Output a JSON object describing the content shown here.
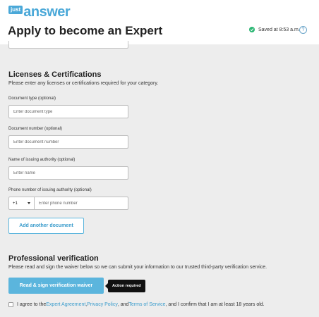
{
  "header": {
    "logo_just": "just",
    "logo_answer": "answer",
    "title": "Apply to become an Expert",
    "saved_text": "Saved at 8:53 a.m.",
    "help_glyph": "?"
  },
  "licenses": {
    "title": "Licenses & Certifications",
    "subtitle": "Please enter any licenses or certifications required for your category.",
    "document_type": {
      "label": "Document type (optional)",
      "placeholder": "Enter document type"
    },
    "document_number": {
      "label": "Document number (optional)",
      "placeholder": "Enter document number"
    },
    "issuing_authority": {
      "label": "Name of issuing authority (optional)",
      "placeholder": "Enter name"
    },
    "phone": {
      "label": "Phone number of issuing authority (optional)",
      "country_code": "+1",
      "placeholder": "Enter phone number"
    },
    "add_button": "Add another document"
  },
  "verification": {
    "title": "Professional verification",
    "subtitle": "Please read and sign the waiver below so we can submit your information to our trusted third-party verification service.",
    "waiver_button": "Read & sign verification waiver",
    "action_badge": "Action required",
    "agree_prefix": "I agree to the ",
    "expert_agreement": "Expert Agreement",
    "comma1": ", ",
    "privacy_policy": "Privacy Policy",
    "and_text": ", and ",
    "terms": "Terms of Service",
    "agree_suffix": ", and I confirm that I am at least 18 years old."
  },
  "colors": {
    "accent": "#5bb5dd",
    "success": "#2bb673",
    "background": "#ededed"
  },
  "icons": [
    "check-circle-icon",
    "help-icon",
    "caret-down-icon"
  ]
}
